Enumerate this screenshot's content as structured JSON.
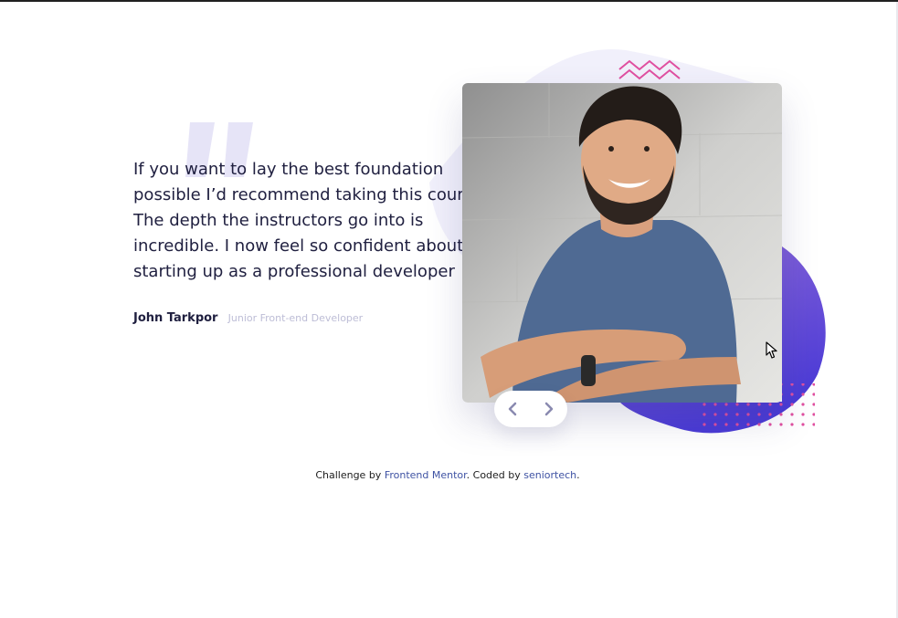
{
  "testimonial": {
    "quote": "If you want to lay the best foundation possible I’d recommend taking this course. The depth the instructors go into is incredible. I now feel so confident about starting up as a professional developer",
    "author_name": "John Tarkpor",
    "author_role": "Junior Front-end Developer"
  },
  "photo": {
    "subject": "smiling man in blue t-shirt with crossed arms"
  },
  "slider": {
    "prev_icon": "chevron-left-icon",
    "next_icon": "chevron-right-icon"
  },
  "footer": {
    "prefix": "Challenge by ",
    "link1": "Frontend Mentor",
    "middle": ". Coded by ",
    "link2": "seniortech",
    "suffix": "."
  },
  "colors": {
    "text_dark": "#202040",
    "text_muted": "#bdbdd6",
    "accent_purple": "#5847d6",
    "accent_pink": "#e04fa0",
    "bg_shape": "#f1f0fb",
    "link": "#3e52a3"
  }
}
